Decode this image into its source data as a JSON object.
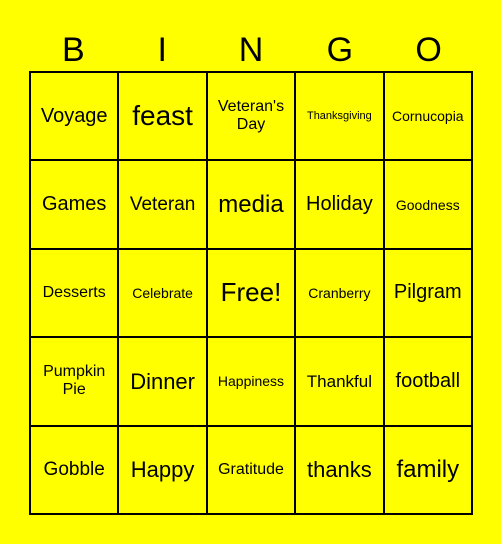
{
  "header": {
    "letters": [
      "B",
      "I",
      "N",
      "G",
      "O"
    ]
  },
  "colors": {
    "background": "#ffff00",
    "lines": "#000000"
  },
  "board": {
    "rows": [
      [
        "Voyage",
        "feast",
        "Veteran's Day",
        "Thanksgiving",
        "Cornucopia"
      ],
      [
        "Games",
        "Veteran",
        "media",
        "Holiday",
        "Goodness"
      ],
      [
        "Desserts",
        "Celebrate",
        "Free!",
        "Cranberry",
        "Pilgram"
      ],
      [
        "Pumpkin Pie",
        "Dinner",
        "Happiness",
        "Thankful",
        "football"
      ],
      [
        "Gobble",
        "Happy",
        "Gratitude",
        "thanks",
        "family"
      ]
    ]
  }
}
